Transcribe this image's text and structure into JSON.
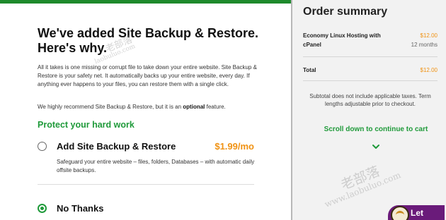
{
  "upsell": {
    "headline": "We've added Site Backup & Restore. Here's why.",
    "paragraph1": "All it takes is one missing or corrupt file to take down your entire website. Site Backup & Restore is your safety net. It automatically backs up your entire website, every day. If anything ever happens to your files, you can restore them with a single click.",
    "paragraph2_prefix": "We highly recommend Site Backup & Restore, but it is an ",
    "paragraph2_bold": "optional",
    "paragraph2_suffix": " feature.",
    "section_heading": "Protect your hard work",
    "options": [
      {
        "label": "Add Site Backup & Restore",
        "price": "$1.99/mo",
        "description": "Safeguard your entire website – files, folders, Databases – with automatic daily offsite backups.",
        "selected": false
      },
      {
        "label": "No Thanks",
        "selected": true
      }
    ]
  },
  "order_summary": {
    "title": "Order summary",
    "item_name": "Economy Linux Hosting with cPanel",
    "item_price": "$12.00",
    "item_term": "12 months",
    "total_label": "Total",
    "total_value": "$12.00",
    "note": "Subtotal does not include applicable taxes. Term lengths adjustable prior to checkout.",
    "scroll_cta": "Scroll down to continue to cart",
    "badge_text": "Let"
  },
  "watermark": {
    "cn": "老部落",
    "url": "www.laobuluo.com",
    "cn_small": "老部落",
    "url_small": "laobuluo.com"
  },
  "colors": {
    "brand_green": "#1e8a2c",
    "price_orange": "#f09213",
    "sidebar_bg": "#f2f2f2",
    "badge_purple": "#6a1b7a"
  }
}
